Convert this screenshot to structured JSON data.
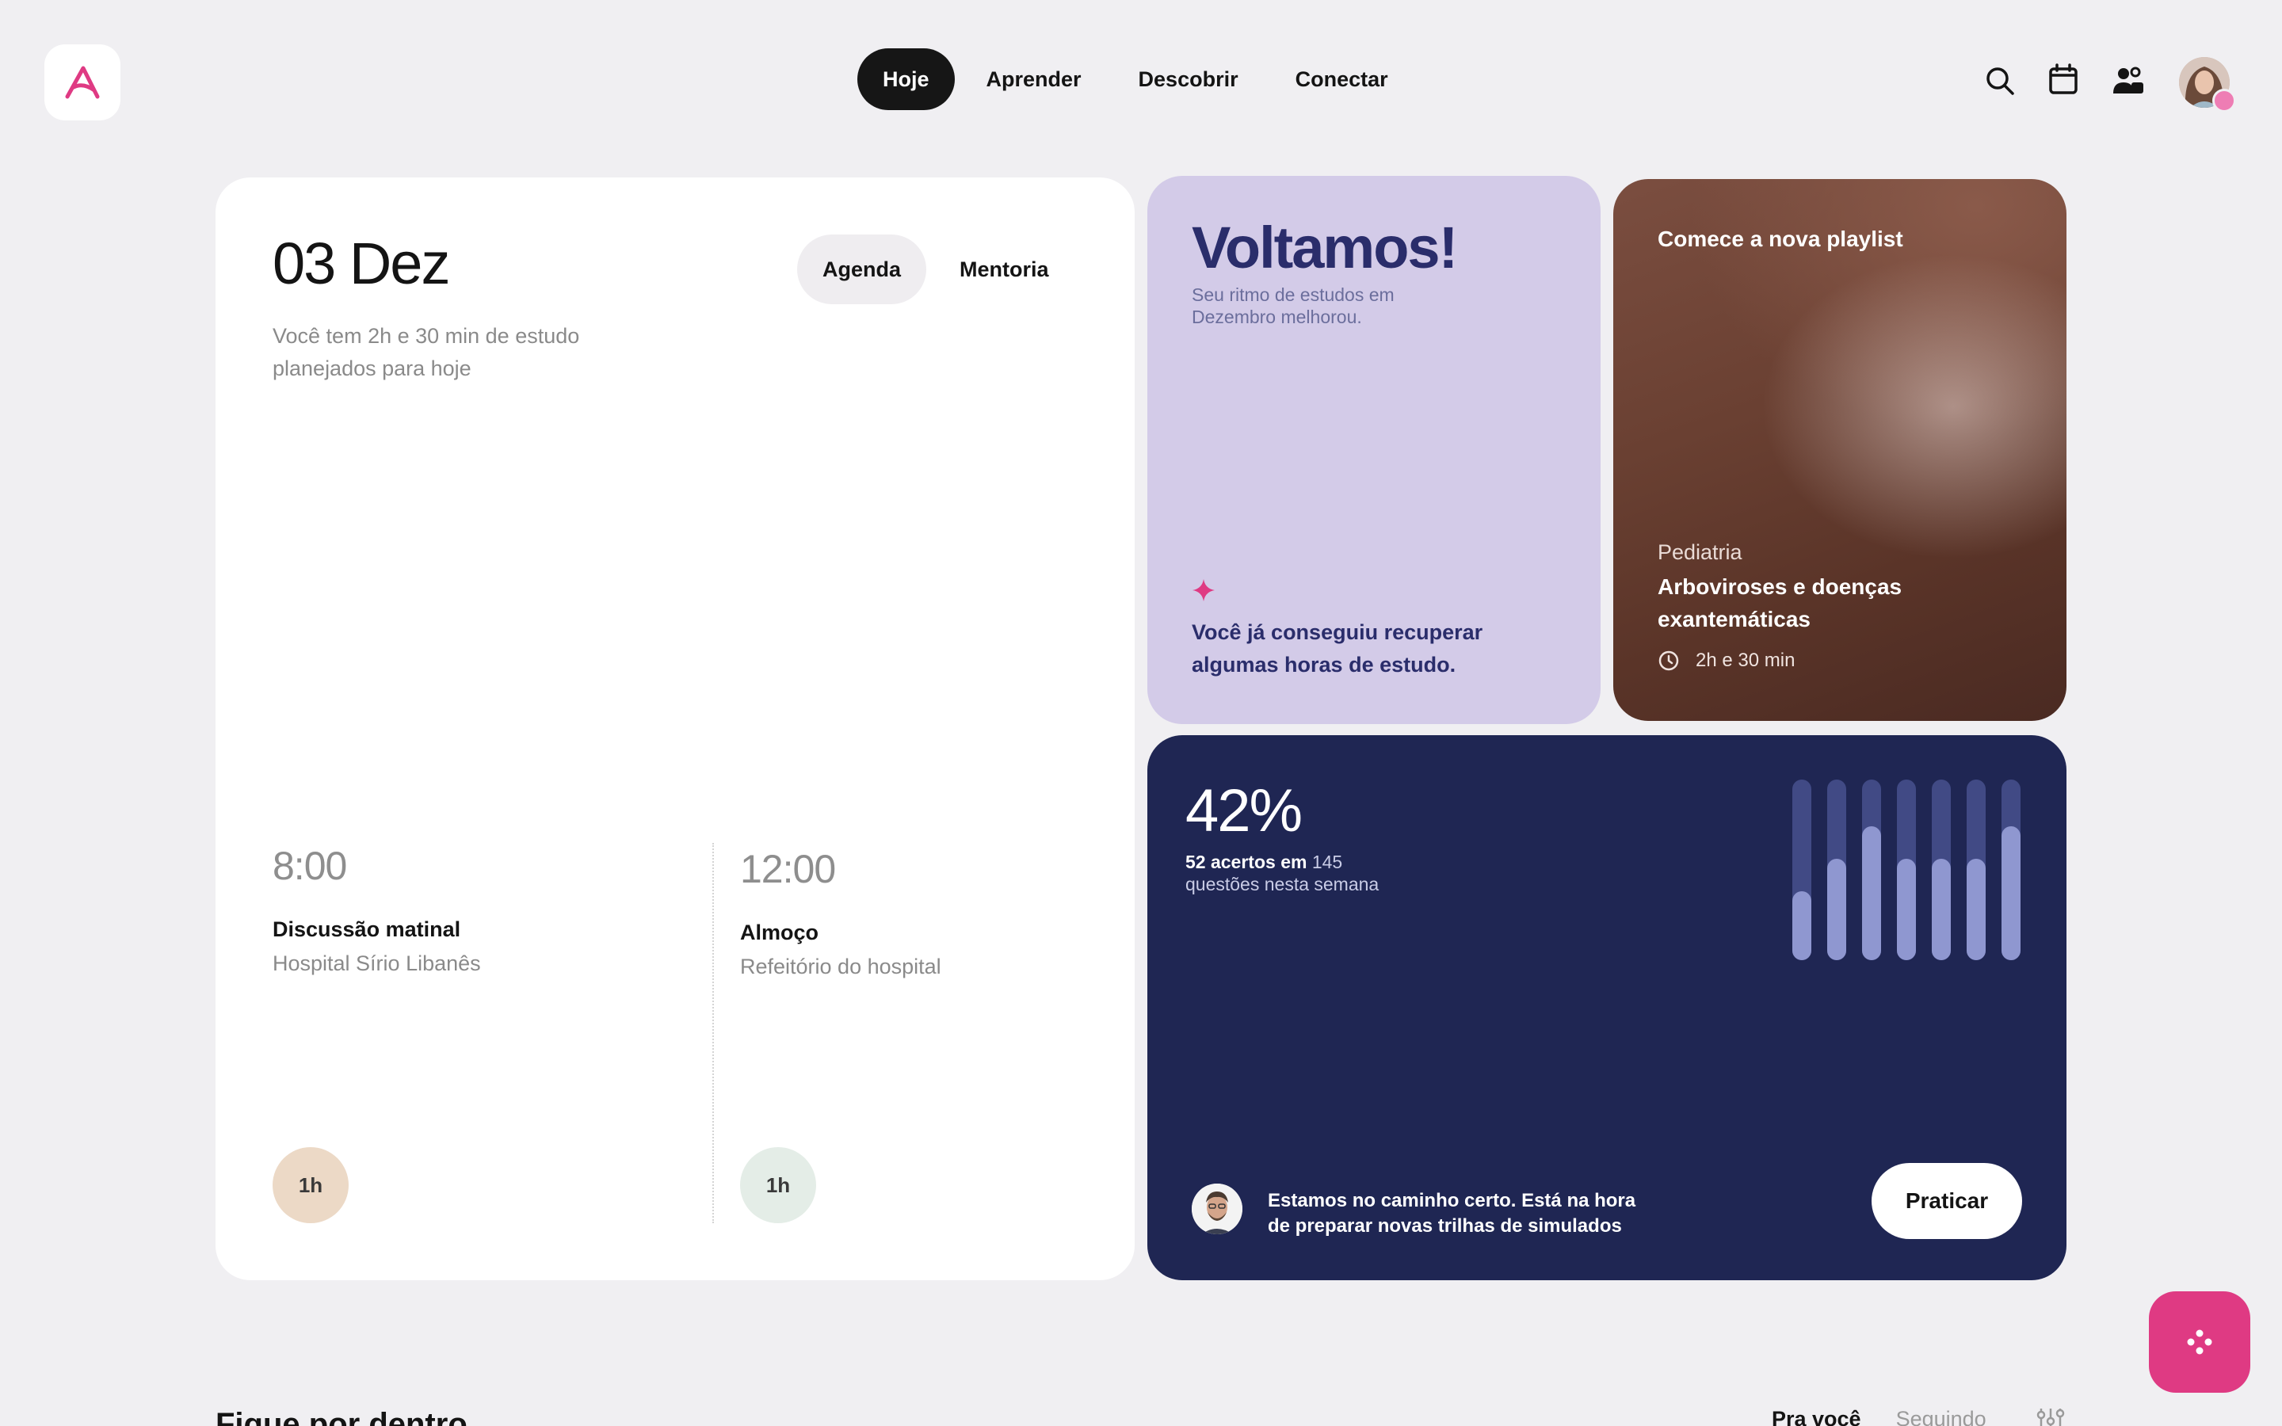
{
  "nav": {
    "items": [
      {
        "label": "Hoje",
        "active": true
      },
      {
        "label": "Aprender",
        "active": false
      },
      {
        "label": "Descobrir",
        "active": false
      },
      {
        "label": "Conectar",
        "active": false
      }
    ]
  },
  "header_icons": [
    "search-icon",
    "calendar-icon",
    "community-icon"
  ],
  "colors": {
    "brand": "#df3a83",
    "welcome_card": "#d3cbe8",
    "stats_card": "#1f2653",
    "page_bg": "#f0eff2"
  },
  "today": {
    "date": "03 Dez",
    "subtitle": "Você tem 2h e 30 min de estudo planejados para hoje",
    "toggle": {
      "agenda": "Agenda",
      "mentoria": "Mentoria"
    },
    "events": [
      {
        "time": "8:00",
        "title": "Discussão matinal",
        "place": "Hospital Sírio Libanês",
        "duration": "1h",
        "color": "#ecd9c6"
      },
      {
        "time": "12:00",
        "title": "Almoço",
        "place": "Refeitório do hospital",
        "duration": "1h",
        "color": "#e4ede7"
      }
    ]
  },
  "welcome": {
    "title": "Voltamos!",
    "subtitle": "Seu ritmo de estudos em Dezembro melhorou.",
    "note": "Você já conseguiu recuperar algumas horas de estudo."
  },
  "playlist": {
    "heading": "Comece a nova playlist",
    "category": "Pediatria",
    "title": "Arboviroses e doenças exantemáticas",
    "duration": "2h e 30 min"
  },
  "stats": {
    "percent": "42%",
    "correct": "52 acertos em",
    "total": "145",
    "suffix": "questões nesta semana",
    "bar_levels": [
      0.38,
      0.56,
      0.74,
      0.56,
      0.56,
      0.56,
      0.74
    ],
    "coach_message": "Estamos no caminho certo. Está na hora de preparar novas trilhas de simulados",
    "cta": "Praticar"
  },
  "feed": {
    "title": "Fique por dentro",
    "tabs": [
      {
        "label": "Pra você",
        "active": true
      },
      {
        "label": "Seguindo",
        "active": false
      }
    ]
  }
}
